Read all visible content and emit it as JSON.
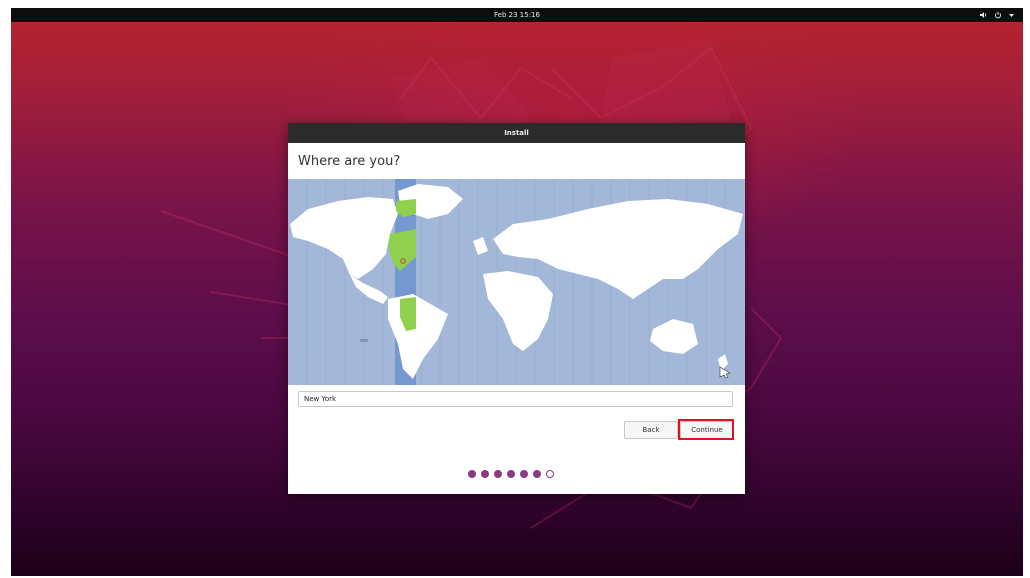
{
  "topbar": {
    "clock": "Feb 23  15:16",
    "volume_icon": "speaker-icon",
    "power_icon": "power-icon",
    "menu_icon": "chevron-down-icon"
  },
  "window": {
    "title": "Install",
    "heading": "Where are you?",
    "timezone_value": "New York",
    "back_label": "Back",
    "continue_label": "Continue"
  },
  "progress": {
    "total_steps": 7,
    "completed_steps": 6
  },
  "colors": {
    "map_ocean": "#a3b7d9",
    "selected_zone": "#8fd14f",
    "progress_dot": "#8b3a83",
    "highlight": "#e0141f"
  }
}
